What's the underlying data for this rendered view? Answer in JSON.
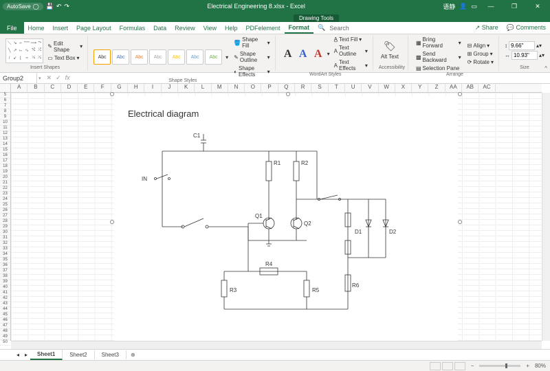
{
  "titlebar": {
    "autosave": "AutoSave",
    "filename": "Electrical Engineering 8.xlsx - Excel",
    "tooltab_group": "Drawing Tools",
    "user": "语静"
  },
  "tabs": {
    "file": "File",
    "items": [
      "Home",
      "Insert",
      "Page Layout",
      "Formulas",
      "Data",
      "Review",
      "View",
      "Help",
      "PDFelement",
      "Format"
    ],
    "active": "Format",
    "search": "Search",
    "share": "Share",
    "comments": "Comments"
  },
  "ribbon": {
    "insert_shapes": {
      "edit": "Edit Shape",
      "textbox": "Text Box",
      "label": "Insert Shapes"
    },
    "shape_styles": {
      "swatch": "Abc",
      "fill": "Shape Fill",
      "outline": "Shape Outline",
      "effects": "Shape Effects",
      "label": "Shape Styles"
    },
    "wordart": {
      "fill": "Text Fill",
      "outline": "Text Outline",
      "effects": "Text Effects",
      "label": "WordArt Styles"
    },
    "accessibility": {
      "alt": "Alt Text",
      "label": "Accessibility"
    },
    "arrange": {
      "forward": "Bring Forward",
      "backward": "Send Backward",
      "selection": "Selection Pane",
      "align": "Align",
      "group": "Group",
      "rotate": "Rotate",
      "label": "Arrange"
    },
    "size": {
      "height": "9.66\"",
      "width": "10.93\"",
      "label": "Size"
    }
  },
  "formula_bar": {
    "namebox": "Group2"
  },
  "columns": [
    "A",
    "B",
    "C",
    "D",
    "E",
    "F",
    "G",
    "H",
    "I",
    "J",
    "K",
    "L",
    "M",
    "N",
    "O",
    "P",
    "Q",
    "R",
    "S",
    "T",
    "U",
    "V",
    "W",
    "X",
    "Y",
    "Z",
    "AA",
    "AB",
    "AC"
  ],
  "row_start": 5,
  "row_end": 50,
  "diagram": {
    "title": "Electrical diagram",
    "labels": {
      "c1": "C1",
      "in": "IN",
      "r1": "R1",
      "r2": "R2",
      "q1": "Q1",
      "q2": "Q2",
      "d1": "D1",
      "d2": "D2",
      "r3": "R3",
      "r4": "R4",
      "r5": "R5",
      "r6": "R6"
    }
  },
  "sheets": {
    "items": [
      "Sheet1",
      "Sheet2",
      "Sheet3"
    ],
    "active": "Sheet1"
  },
  "statusbar": {
    "zoom": "80%"
  }
}
